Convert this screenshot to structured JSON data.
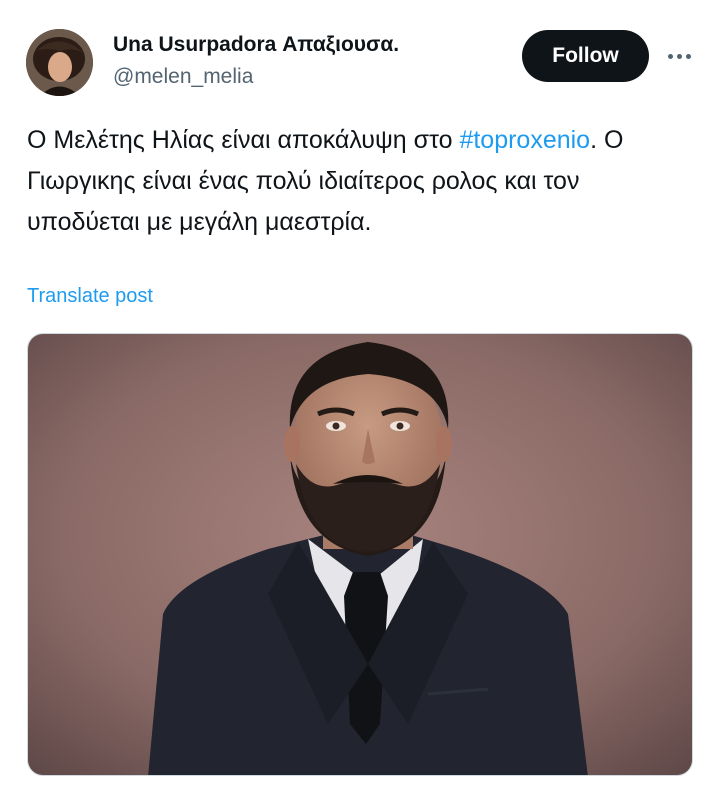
{
  "author": {
    "display_name": "Una Usurpadora Απαξιουσα.",
    "handle": "@melen_melia"
  },
  "actions": {
    "follow_label": "Follow"
  },
  "post": {
    "text_before": "Ο Μελέτης Ηλίας είναι αποκάλυψη στο ",
    "hashtag": "#toproxenio",
    "text_after": ". Ο Γιωργικης είναι ένας πολύ ιδιαίτερος ρολος και τον υποδύεται με μεγάλη μαεστρία.",
    "translate_label": "Translate post"
  },
  "colors": {
    "link": "#1d9bf0",
    "text": "#0f1419",
    "secondary": "#536471",
    "button": "#0f1419"
  },
  "icons": {
    "more": "more-horizontal-icon"
  }
}
